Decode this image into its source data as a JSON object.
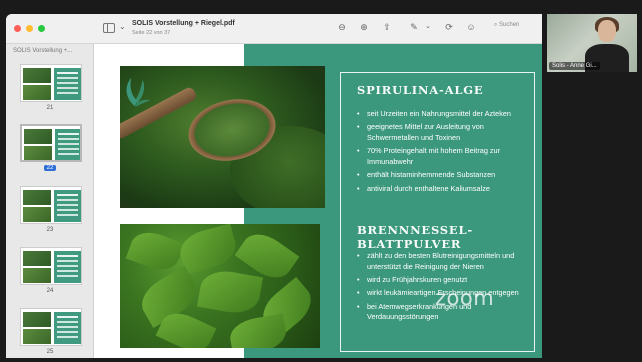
{
  "window": {
    "title": "SOLIS Vorstellung + Riegel.pdf",
    "subtitle": "Seite 22 von 37",
    "search_placeholder": "Suchen"
  },
  "sidebar": {
    "header": "SOLIS Vorstellung +...",
    "pages": [
      {
        "num": "21"
      },
      {
        "num": "22"
      },
      {
        "num": "23"
      },
      {
        "num": "24"
      },
      {
        "num": "25"
      }
    ],
    "selected_page": "22"
  },
  "slide": {
    "section1": {
      "heading": "SPIRULINA-ALGE",
      "bullets": [
        "seit Urzeiten ein Nahrungsmittel der Azteken",
        "geeignetes Mittel zur Ausleitung von Schwermetallen und Toxinen",
        "70% Proteingehalt mit hohem Beitrag zur Immunabwehr",
        "enthält histaminhemmende Substanzen",
        "antiviral durch enthaltene Kaliumsalze"
      ]
    },
    "section2": {
      "heading": "BRENNNESSEL-BLATTPULVER",
      "bullets": [
        "zählt zu den besten Blutreinigungsmitteln und unterstützt die Reinigung der Nieren",
        "wird zu Frühjahrskuren genutzt",
        "wirkt leukämieartigen Erscheinungen entgegen",
        "bei Atemwegserkrankungen und Verdauungsstörungen"
      ]
    },
    "accent_color": "#3c987c"
  },
  "video": {
    "participant_name": "Solis - Anne Gi..."
  },
  "watermark": "zoom",
  "icons": [
    "sidebar-toggle-icon",
    "zoom-out-icon",
    "zoom-in-icon",
    "share-icon",
    "markup-pen-icon",
    "rotate-icon",
    "annotate-icon",
    "search-icon"
  ]
}
